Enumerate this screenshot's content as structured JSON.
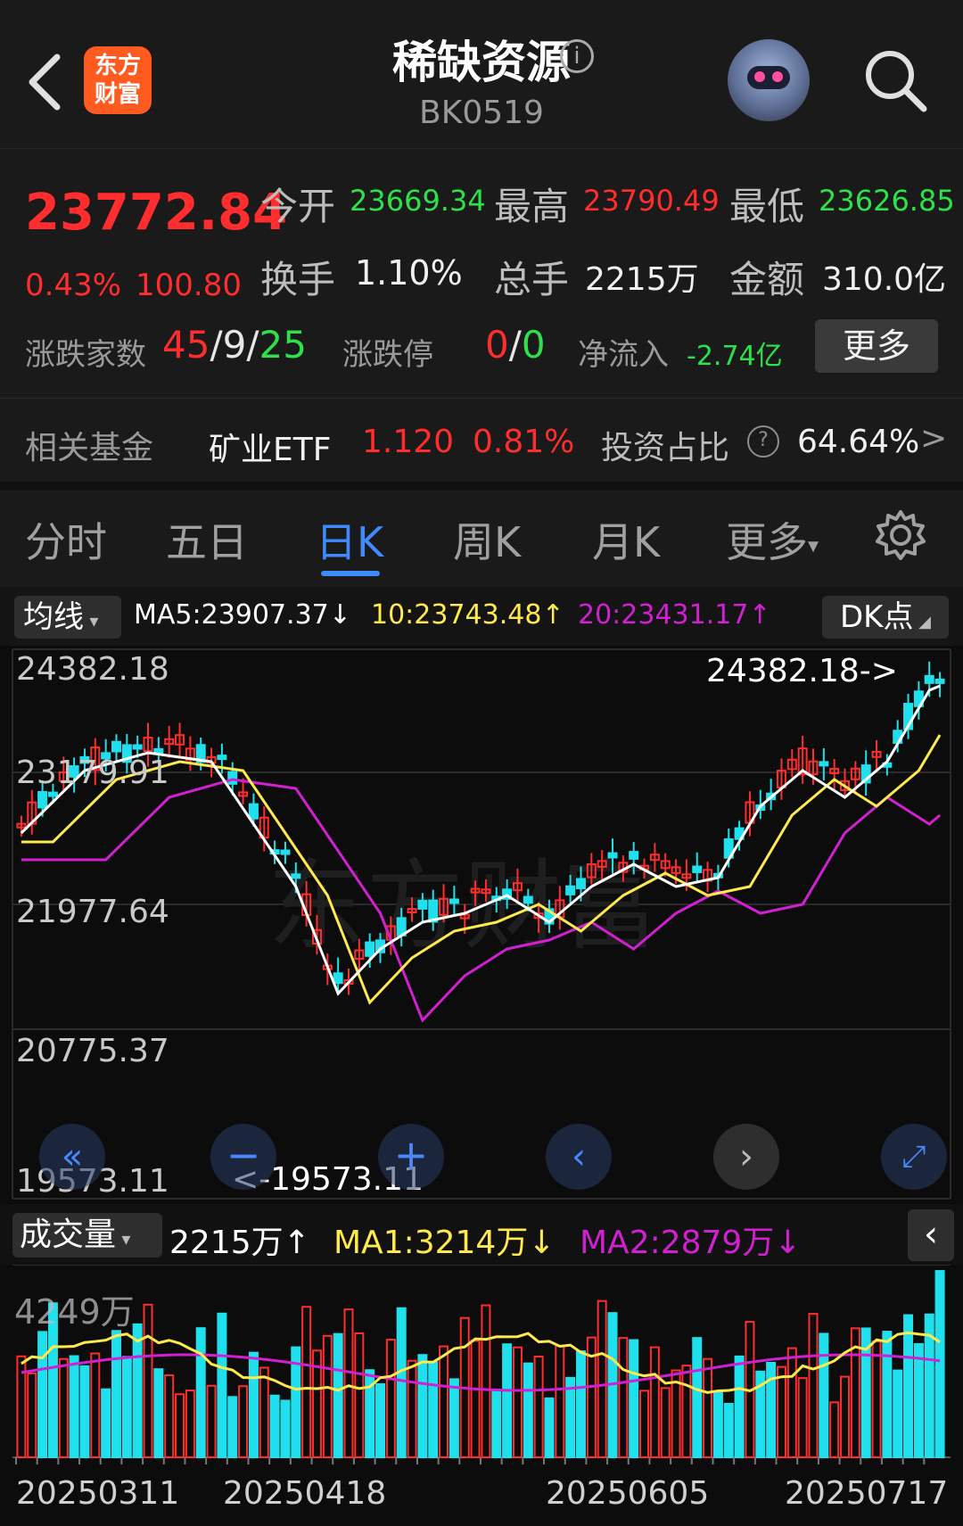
{
  "header": {
    "logo_text_line1": "东方",
    "logo_text_line2": "财富",
    "title": "稀缺资源",
    "code": "BK0519",
    "icons": {
      "back": "chevron-left-icon",
      "info": "info-icon",
      "avatar": "robot-avatar",
      "search": "search-icon"
    }
  },
  "quote": {
    "price": "23772.84",
    "change_pct": "0.43%",
    "change_val": "100.80",
    "open_label": "今开",
    "open": "23669.34",
    "high_label": "最高",
    "high": "23790.49",
    "low_label": "最低",
    "low": "23626.85",
    "turnover_label": "换手",
    "turnover": "1.10%",
    "volume_label": "总手",
    "volume": "2215万",
    "amount_label": "金额",
    "amount": "310.0亿",
    "adv_label": "涨跌家数",
    "adv_up": "45",
    "adv_flat": "9",
    "adv_down": "25",
    "slash": "/",
    "limit_label": "涨跌停",
    "limit_up": "0",
    "limit_down": "0",
    "netflow_label": "净流入",
    "netflow": "-2.74亿",
    "more_label": "更多"
  },
  "fund": {
    "label": "相关基金",
    "name": "矿业ETF",
    "price": "1.120",
    "pct": "0.81%",
    "ratio_label": "投资占比",
    "ratio": "64.64%",
    "arrow": ">"
  },
  "tabs": [
    {
      "label": "分时"
    },
    {
      "label": "五日"
    },
    {
      "label": "日K"
    },
    {
      "label": "周K"
    },
    {
      "label": "月K"
    },
    {
      "label": "更多"
    }
  ],
  "ma_bar": {
    "selector": "均线",
    "ma5": "MA5:23907.37",
    "ma10": "10:23743.48",
    "ma20": "20:23431.17",
    "dk": "DK点"
  },
  "price_axis": [
    "24382.18",
    "23179.91",
    "21977.64",
    "20775.37",
    "19573.11"
  ],
  "annotations": {
    "high_mark": "24382.18->",
    "low_mark": "<-19573.11"
  },
  "volume_bar": {
    "selector": "成交量",
    "vol": "2215万",
    "ma1": "MA1:3214万",
    "ma2": "MA2:2879万"
  },
  "volume_axis_max": "4249万",
  "dates": [
    "20250311",
    "20250418",
    "20250605",
    "20250717"
  ],
  "colors": {
    "up": "#ff2d2d",
    "down": "#1fe0ec",
    "ma5": "#ffffff",
    "ma10": "#ffe94d",
    "ma20": "#d21fd2",
    "accent": "#3d8bff"
  }
}
